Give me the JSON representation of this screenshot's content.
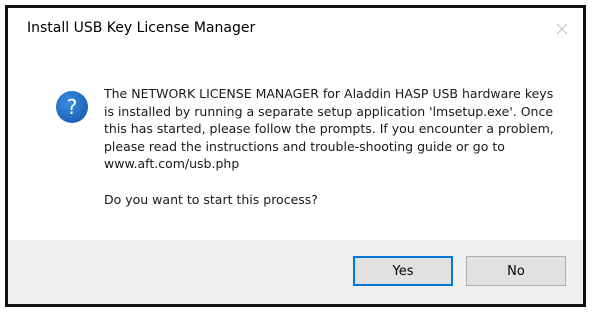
{
  "dialog": {
    "title": "Install USB Key License Manager",
    "icon": "question-icon",
    "close_icon": "close-icon",
    "message": "The NETWORK LICENSE MANAGER for Aladdin HASP USB hardware keys is installed by running a separate setup application 'lmsetup.exe'. Once this has started, please follow the prompts. If you encounter a problem, please read the instructions and trouble-shooting guide or go to www.aft.com/usb.php",
    "question": "Do you want to start this process?",
    "buttons": {
      "yes_label": "Yes",
      "no_label": "No"
    },
    "colors": {
      "icon_blue": "#1e6fc6",
      "focus_border": "#0078d7",
      "footer_bg": "#f0f0f0"
    }
  }
}
